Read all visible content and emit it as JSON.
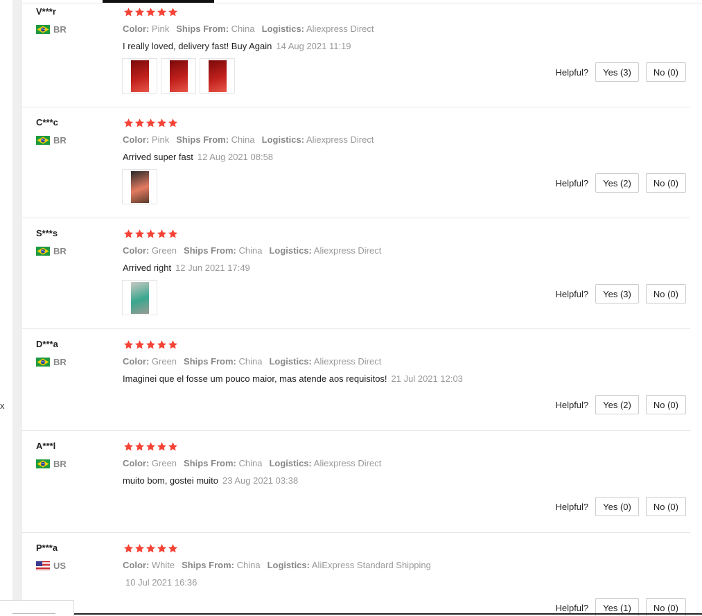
{
  "colors": {
    "star": "#f44336",
    "brazil_green": "#1d9a3f",
    "brazil_yellow": "#f5d000",
    "brazil_blue": "#1c3f94"
  },
  "side_mark": "x",
  "helpful_label": "Helpful?",
  "attribute_labels": {
    "color": "Color:",
    "ships_from": "Ships From:",
    "logistics": "Logistics:"
  },
  "reviews": [
    {
      "user": "V***r",
      "country": "BR",
      "rating": 5,
      "color": "Pink",
      "ships_from": "China",
      "logistics": "Aliexpress Direct",
      "comment": "I really loved, delivery fast! Buy Again",
      "date": "14 Aug 2021 11:19",
      "photos": [
        "red-product-photo",
        "red-product-photo",
        "red-product-photo"
      ],
      "yes": "Yes (3)",
      "no": "No (0)"
    },
    {
      "user": "C***c",
      "country": "BR",
      "rating": 5,
      "color": "Pink",
      "ships_from": "China",
      "logistics": "Aliexpress Direct",
      "comment": "Arrived super fast",
      "date": "12 Aug 2021 08:58",
      "photos": [
        "pink-humidifier-photo"
      ],
      "yes": "Yes (2)",
      "no": "No (0)"
    },
    {
      "user": "S***s",
      "country": "BR",
      "rating": 5,
      "color": "Green",
      "ships_from": "China",
      "logistics": "Aliexpress Direct",
      "comment": "Arrived right",
      "date": "12 Jun 2021 17:49",
      "photos": [
        "green-humidifier-photo"
      ],
      "yes": "Yes (3)",
      "no": "No (0)"
    },
    {
      "user": "D***a",
      "country": "BR",
      "rating": 5,
      "color": "Green",
      "ships_from": "China",
      "logistics": "Aliexpress Direct",
      "comment": "Imaginei que el fosse um pouco maior, mas atende aos requisitos!",
      "date": "21 Jul 2021 12:03",
      "photos": [],
      "yes": "Yes (2)",
      "no": "No (0)"
    },
    {
      "user": "A***l",
      "country": "BR",
      "rating": 5,
      "color": "Green",
      "ships_from": "China",
      "logistics": "Aliexpress Direct",
      "comment": "muito bom, gostei muito",
      "date": "23 Aug 2021 03:38",
      "photos": [],
      "yes": "Yes (0)",
      "no": "No (0)"
    },
    {
      "user": "P***a",
      "country": "US",
      "rating": 5,
      "color": "White",
      "ships_from": "China",
      "logistics": "AliExpress Standard Shipping",
      "comment": "",
      "date": "10 Jul 2021 16:36",
      "photos": [],
      "yes": "Yes (1)",
      "no": "No (0)"
    }
  ]
}
